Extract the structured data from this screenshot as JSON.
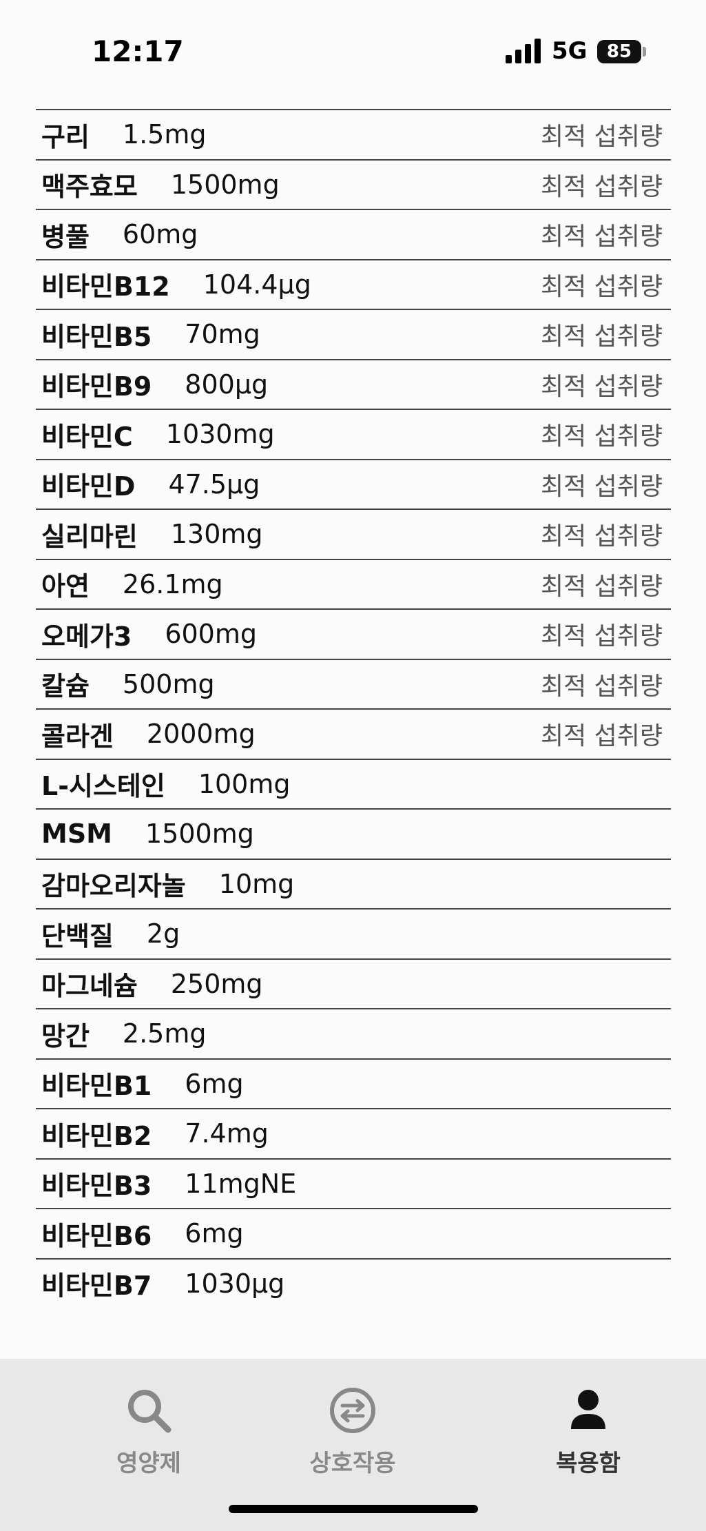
{
  "status_bar": {
    "time": "12:17",
    "network": "5G",
    "battery": "85"
  },
  "supplements": [
    {
      "name": "구리",
      "amount": "1.5mg",
      "tag": "최적 섭취량"
    },
    {
      "name": "맥주효모",
      "amount": "1500mg",
      "tag": "최적 섭취량"
    },
    {
      "name": "병풀",
      "amount": "60mg",
      "tag": "최적 섭취량"
    },
    {
      "name": "비타민B12",
      "amount": "104.4μg",
      "tag": "최적 섭취량"
    },
    {
      "name": "비타민B5",
      "amount": "70mg",
      "tag": "최적 섭취량"
    },
    {
      "name": "비타민B9",
      "amount": "800μg",
      "tag": "최적 섭취량"
    },
    {
      "name": "비타민C",
      "amount": "1030mg",
      "tag": "최적 섭취량"
    },
    {
      "name": "비타민D",
      "amount": "47.5μg",
      "tag": "최적 섭취량"
    },
    {
      "name": "실리마린",
      "amount": "130mg",
      "tag": "최적 섭취량"
    },
    {
      "name": "아연",
      "amount": "26.1mg",
      "tag": "최적 섭취량"
    },
    {
      "name": "오메가3",
      "amount": "600mg",
      "tag": "최적 섭취량"
    },
    {
      "name": "칼슘",
      "amount": "500mg",
      "tag": "최적 섭취량"
    },
    {
      "name": "콜라겐",
      "amount": "2000mg",
      "tag": "최적 섭취량"
    },
    {
      "name": "L-시스테인",
      "amount": "100mg",
      "tag": ""
    },
    {
      "name": "MSM",
      "amount": "1500mg",
      "tag": ""
    },
    {
      "name": "감마오리자놀",
      "amount": "10mg",
      "tag": ""
    },
    {
      "name": "단백질",
      "amount": "2g",
      "tag": ""
    },
    {
      "name": "마그네슘",
      "amount": "250mg",
      "tag": ""
    },
    {
      "name": "망간",
      "amount": "2.5mg",
      "tag": ""
    },
    {
      "name": "비타민B1",
      "amount": "6mg",
      "tag": ""
    },
    {
      "name": "비타민B2",
      "amount": "7.4mg",
      "tag": ""
    },
    {
      "name": "비타민B3",
      "amount": "11mgNE",
      "tag": ""
    },
    {
      "name": "비타민B6",
      "amount": "6mg",
      "tag": ""
    },
    {
      "name": "비타민B7",
      "amount": "1030μg",
      "tag": ""
    }
  ],
  "tabs": [
    {
      "label": "영양제",
      "icon": "search-icon",
      "active": false
    },
    {
      "label": "상호작용",
      "icon": "swap-icon",
      "active": false
    },
    {
      "label": "복용함",
      "icon": "person-icon",
      "active": true
    }
  ],
  "colors": {
    "tab_inactive": "#888888",
    "tab_active": "#333333",
    "tag_text": "#555555"
  }
}
